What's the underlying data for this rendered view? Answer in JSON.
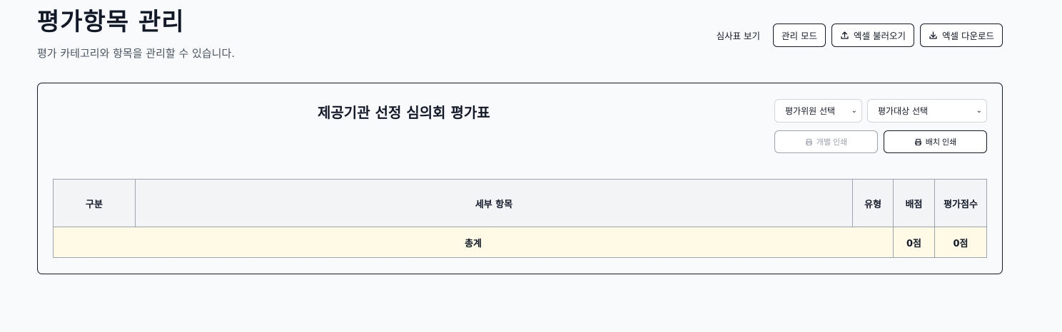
{
  "header": {
    "title": "평가항목 관리",
    "subtitle": "평가 카테고리와 항목을 관리할 수 있습니다."
  },
  "actions": {
    "view_sheet": "심사표 보기",
    "admin_mode": "관리 모드",
    "excel_import": "엑셀 불러오기",
    "excel_download": "엑셀 다운로드"
  },
  "card": {
    "title": "제공기관 선정 심의회 평가표",
    "evaluator_select": "평가위원 선택",
    "target_select": "평가대상 선택",
    "print_individual": "개별 인쇄",
    "print_batch": "배치 인쇄"
  },
  "table": {
    "headers": [
      "구분",
      "세부 항목",
      "유형",
      "배점",
      "평가점수"
    ],
    "total_row": {
      "label": "총계",
      "allotted": "0점",
      "score": "0점"
    }
  },
  "icons": {
    "upload": "upload-icon",
    "download": "download-icon",
    "print": "printer-icon",
    "chevron": "chevron-down-icon"
  }
}
